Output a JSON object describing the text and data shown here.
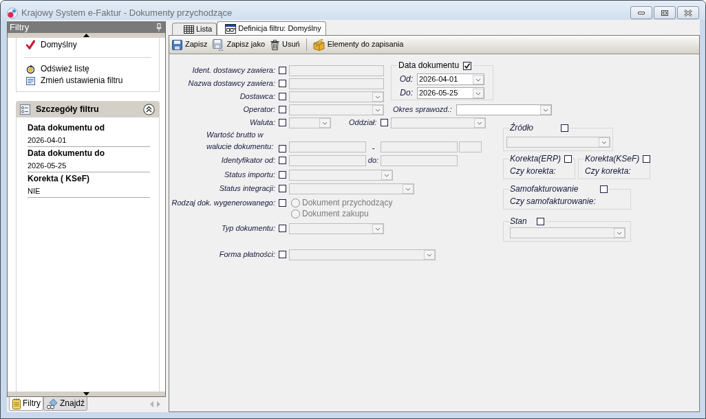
{
  "window": {
    "title": "Krajowy System e-Faktur - Dokumenty przychodzące"
  },
  "side_panel": {
    "title": "Filtry",
    "filters": [
      {
        "label": "Domyślny",
        "checked": true
      }
    ],
    "actions": [
      {
        "label": "Odśwież listę",
        "kind": "refresh"
      },
      {
        "label": "Zmień ustawienia filtru",
        "kind": "settings"
      }
    ],
    "details": {
      "title": "Szczegóły filtru",
      "expanded": true,
      "items": [
        {
          "label": "Data dokumentu od",
          "value": "2026-04-01"
        },
        {
          "label": "Data dokumentu do",
          "value": "2026-05-25"
        },
        {
          "label": "Korekta ( KSeF)",
          "value": "NIE"
        }
      ]
    },
    "tabs": [
      {
        "label": "Filtry",
        "selected": true,
        "kind": "filters"
      },
      {
        "label": "Znajdź",
        "selected": false,
        "kind": "find"
      }
    ]
  },
  "tabs": [
    {
      "label": "Lista",
      "selected": false,
      "kind": "list"
    },
    {
      "label": "Definicja filtru: Domyślny",
      "selected": true,
      "kind": "form"
    }
  ],
  "toolbar": [
    {
      "kind": "save",
      "label": "Zapisz"
    },
    {
      "kind": "save_as",
      "label": "Zapisz jako"
    },
    {
      "kind": "delete",
      "label": "Usuń"
    },
    {
      "kind": "separator"
    },
    {
      "kind": "items",
      "label": "Elementy do zapisania"
    }
  ],
  "date_filter": {
    "label": "Data dokumentu",
    "checked": true,
    "from": {
      "label": "Od:",
      "value": "2026-04-01"
    },
    "to": {
      "label": "Do:",
      "value": "2026-05-25"
    }
  },
  "criteria": [
    {
      "label": "Ident. dostawcy zawiera:",
      "checked": false,
      "kind": "text"
    },
    {
      "label": "Nazwa dostawcy zawiera:",
      "checked": false,
      "kind": "text"
    },
    {
      "label": "Dostawca:",
      "checked": false,
      "kind": "combo"
    },
    {
      "label": "Operator:",
      "checked": false,
      "kind": "combo",
      "side": {
        "label": "Okres sprawozd.:",
        "kind": "combo",
        "disabled": false
      }
    },
    {
      "label": "Waluta:",
      "checked": false,
      "kind": "combo",
      "side": {
        "label": "Oddział:",
        "checked": false,
        "kind": "combo"
      }
    },
    {
      "label": "Wartość brutto w walucie dokumentu:",
      "checked": false,
      "kind": "amount_range",
      "separator": "-"
    },
    {
      "label": "Identyfikator od:",
      "checked": false,
      "kind": "range",
      "separator": "do:"
    },
    {
      "label": "Status importu:",
      "checked": false,
      "kind": "combo"
    },
    {
      "label": "Status integracji:",
      "checked": false,
      "kind": "combo"
    },
    {
      "label": "Rodzaj dok. wygenerowanego:",
      "checked": false,
      "kind": "radio",
      "options": [
        {
          "label": "Dokument przychodzący",
          "selected": false
        },
        {
          "label": "Dokument zakupu",
          "selected": false
        }
      ]
    },
    {
      "label": "Typ dokumentu:",
      "checked": false,
      "kind": "combo"
    },
    {
      "label": "Forma płatności:",
      "checked": false,
      "kind": "combo"
    }
  ],
  "groups": [
    {
      "label": "Źródło",
      "checked": false,
      "kind": "combo"
    },
    {
      "label": "Korekta(ERP)",
      "checked": false,
      "kind": "question",
      "question": "Czy korekta:"
    },
    {
      "label": "Korekta(KSeF)",
      "checked": false,
      "kind": "question",
      "question": "Czy korekta:"
    },
    {
      "label": "Samofakturowanie",
      "checked": false,
      "kind": "question",
      "question": "Czy samofakturowanie:"
    },
    {
      "label": "Stan",
      "checked": false,
      "kind": "combo"
    }
  ]
}
